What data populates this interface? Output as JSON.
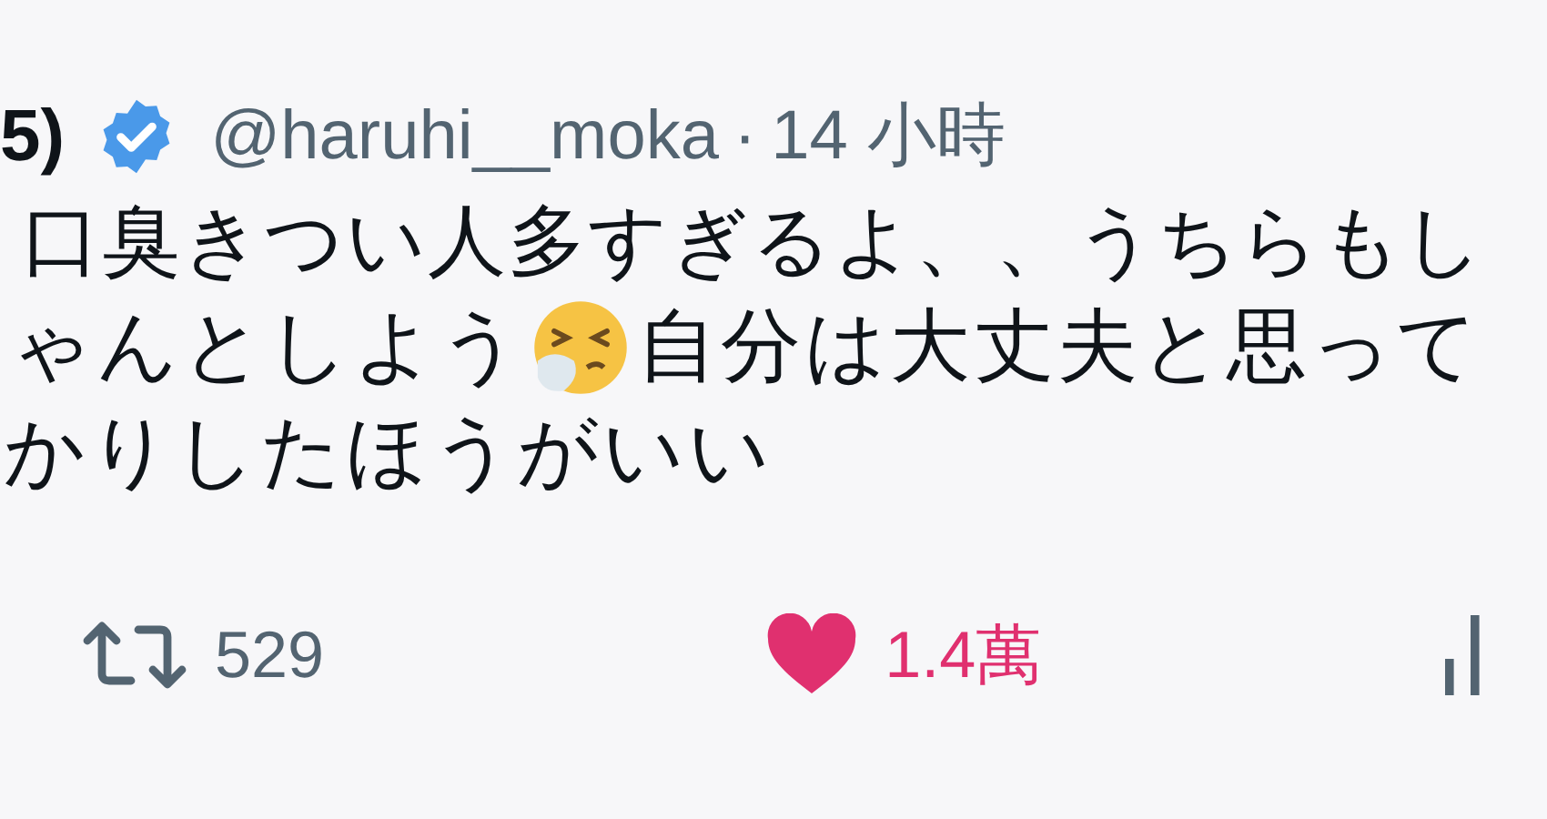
{
  "header": {
    "name": "5)",
    "verified": true,
    "handle": "@haruhi__moka",
    "separator": "·",
    "time": "14 小時"
  },
  "body": [
    [
      {
        "kind": "text",
        "text": "口臭きつい人多すぎるよ、、うちらもし"
      }
    ],
    [
      {
        "kind": "text",
        "text": "ゃんとしよう"
      },
      {
        "kind": "emoji"
      },
      {
        "kind": "text",
        "text": "自分は大丈夫と思って"
      }
    ],
    [
      {
        "kind": "text",
        "text": "かりしたほうがいい"
      }
    ]
  ],
  "actions": {
    "retweets": "529",
    "likes": "1.4萬",
    "liked": true
  }
}
